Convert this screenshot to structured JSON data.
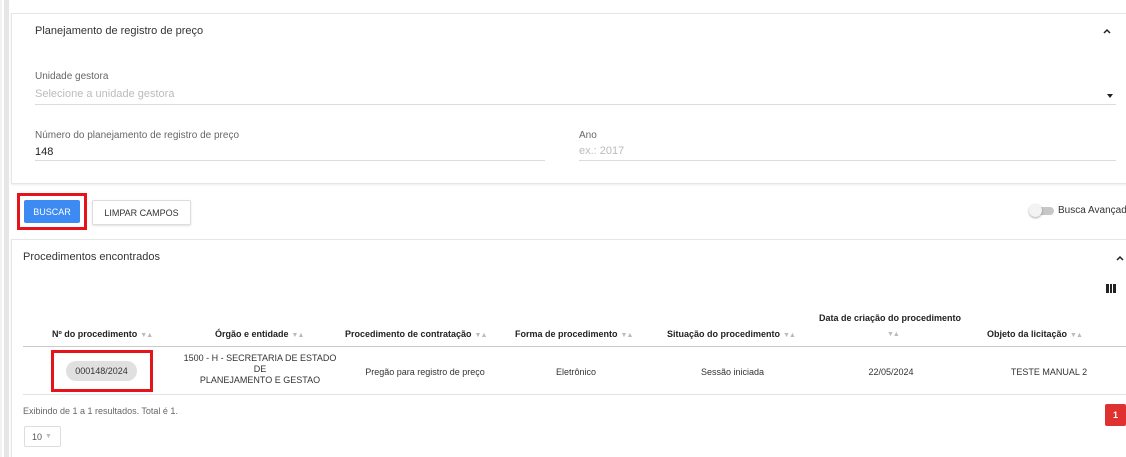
{
  "panel": {
    "title": "Planejamento de registro de preço",
    "unidade_label": "Unidade gestora",
    "unidade_placeholder": "Selecione a unidade gestora",
    "numero_label": "Número do planejamento de registro de preço",
    "numero_value": "148",
    "ano_label": "Ano",
    "ano_placeholder": "ex.: 2017"
  },
  "actions": {
    "buscar": "BUSCAR",
    "limpar": "LIMPAR CAMPOS",
    "busca_avancada": "Busca Avançada"
  },
  "results": {
    "title": "Procedimentos encontrados",
    "sort_glyph": "▼▲",
    "columns": [
      "Nº do procedimento",
      "Órgão e entidade",
      "Procedimento de contratação",
      "Forma de procedimento",
      "Situação do procedimento",
      "Data de criação do procedimento",
      "Objeto da licitação"
    ],
    "rows": [
      {
        "numero": "000148/2024",
        "orgao_line1": "1500 - H - SECRETARIA DE ESTADO",
        "orgao_line2": "DE",
        "orgao_line3": "PLANEJAMENTO E GESTAO",
        "procedimento": "Pregão para registro de preço",
        "forma": "Eletrônico",
        "situacao": "Sessão iniciada",
        "data": "22/05/2024",
        "objeto": "TESTE MANUAL 2"
      }
    ],
    "footer": "Exibindo de 1 a 1 resultados. Total é 1.",
    "page_size": "10",
    "current_page": "1"
  },
  "colors": {
    "primary_button": "#3d8bf2",
    "highlight": "#e5141a",
    "page_active": "#e03131"
  },
  "icons": [
    "chevron-up-icon",
    "dropdown-caret-icon",
    "columns-icon",
    "sort-icon"
  ]
}
